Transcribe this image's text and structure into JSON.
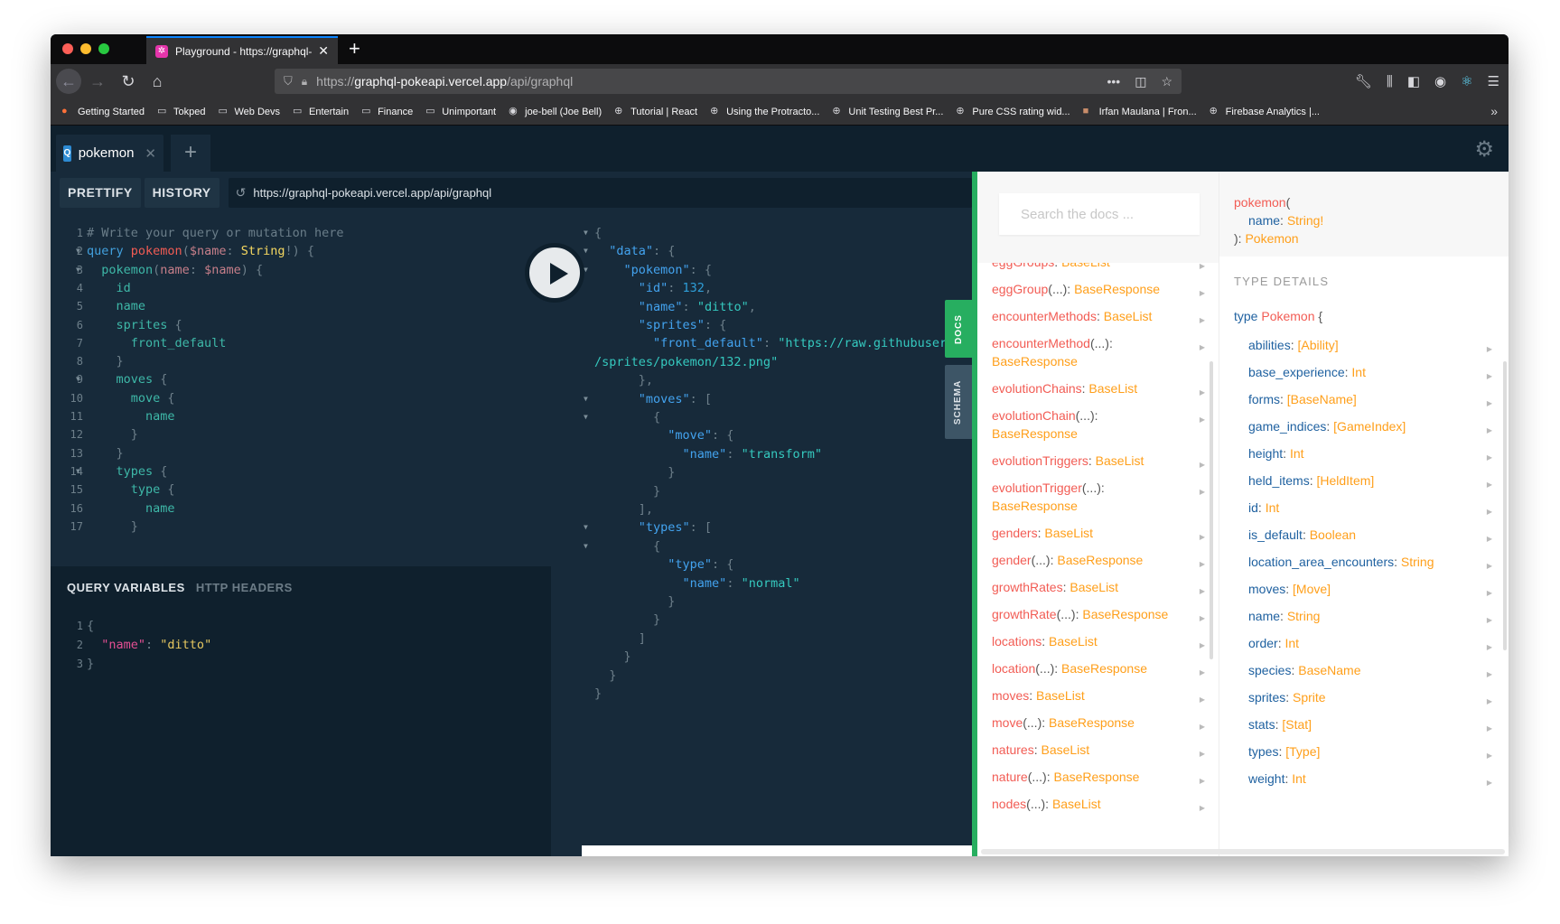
{
  "browser": {
    "tab_title": "Playground - https://graphql-p",
    "tab_favicon": "graphql-logo-icon",
    "url_prefix": "https://",
    "url_host": "graphql-pokeapi.vercel.app",
    "url_path": "/api/graphql",
    "bookmarks": [
      {
        "label": "Getting Started",
        "icon": "firefox-icon"
      },
      {
        "label": "Tokped",
        "icon": "folder-icon"
      },
      {
        "label": "Web Devs",
        "icon": "folder-icon"
      },
      {
        "label": "Entertain",
        "icon": "folder-icon"
      },
      {
        "label": "Finance",
        "icon": "folder-icon"
      },
      {
        "label": "Unimportant",
        "icon": "folder-icon"
      },
      {
        "label": "joe-bell (Joe Bell)",
        "icon": "github-icon"
      },
      {
        "label": "Tutorial | React",
        "icon": "globe-icon"
      },
      {
        "label": "Using the Protracto...",
        "icon": "globe-icon"
      },
      {
        "label": "Unit Testing Best Pr...",
        "icon": "globe-icon"
      },
      {
        "label": "Pure CSS rating wid...",
        "icon": "globe-icon"
      },
      {
        "label": "Irfan Maulana | Fron...",
        "icon": "avatar-icon"
      },
      {
        "label": "Firebase Analytics |...",
        "icon": "globe-icon"
      }
    ]
  },
  "playground": {
    "tab_badge": "Q",
    "tab_name": "pokemon",
    "prettify_label": "PRETTIFY",
    "history_label": "HISTORY",
    "endpoint": "https://graphql-pokeapi.vercel.app/api/graphql",
    "var_tabs": {
      "query_variables": "QUERY VARIABLES",
      "http_headers": "HTTP HEADERS"
    },
    "docs_tab": "DOCS",
    "schema_tab": "SCHEMA"
  },
  "query_lines": [
    {
      "n": "1",
      "fold": false,
      "tokens": [
        [
          "c-comment",
          "# Write your query or mutation here"
        ]
      ]
    },
    {
      "n": "2",
      "fold": true,
      "tokens": [
        [
          "c-kw",
          "query "
        ],
        [
          "c-def",
          "pokemon"
        ],
        [
          "c-punc",
          "("
        ],
        [
          "c-var",
          "$name"
        ],
        [
          "c-punc",
          ": "
        ],
        [
          "c-type",
          "String"
        ],
        [
          "c-punc",
          "!) {"
        ]
      ]
    },
    {
      "n": "3",
      "fold": true,
      "tokens": [
        [
          "c-field",
          "  pokemon"
        ],
        [
          "c-punc",
          "("
        ],
        [
          "c-var",
          "name"
        ],
        [
          "c-punc",
          ": "
        ],
        [
          "c-var",
          "$name"
        ],
        [
          "c-punc",
          ") {"
        ]
      ]
    },
    {
      "n": "4",
      "fold": false,
      "tokens": [
        [
          "c-field",
          "    id"
        ]
      ]
    },
    {
      "n": "5",
      "fold": false,
      "tokens": [
        [
          "c-field",
          "    name"
        ]
      ]
    },
    {
      "n": "6",
      "fold": false,
      "tokens": [
        [
          "c-field",
          "    sprites "
        ],
        [
          "c-punc",
          "{"
        ]
      ]
    },
    {
      "n": "7",
      "fold": false,
      "tokens": [
        [
          "c-field",
          "      front_default"
        ]
      ]
    },
    {
      "n": "8",
      "fold": false,
      "tokens": [
        [
          "c-punc",
          "    }"
        ]
      ]
    },
    {
      "n": "9",
      "fold": true,
      "tokens": [
        [
          "c-field",
          "    moves "
        ],
        [
          "c-punc",
          "{"
        ]
      ]
    },
    {
      "n": "10",
      "fold": false,
      "tokens": [
        [
          "c-field",
          "      move "
        ],
        [
          "c-punc",
          "{"
        ]
      ]
    },
    {
      "n": "11",
      "fold": false,
      "tokens": [
        [
          "c-field",
          "        name"
        ]
      ]
    },
    {
      "n": "12",
      "fold": false,
      "tokens": [
        [
          "c-punc",
          "      }"
        ]
      ]
    },
    {
      "n": "13",
      "fold": false,
      "tokens": [
        [
          "c-punc",
          "    }"
        ]
      ]
    },
    {
      "n": "14",
      "fold": true,
      "tokens": [
        [
          "c-field",
          "    types "
        ],
        [
          "c-punc",
          "{"
        ]
      ]
    },
    {
      "n": "15",
      "fold": false,
      "tokens": [
        [
          "c-field",
          "      type "
        ],
        [
          "c-punc",
          "{"
        ]
      ]
    },
    {
      "n": "16",
      "fold": false,
      "tokens": [
        [
          "c-field",
          "        name"
        ]
      ]
    },
    {
      "n": "17",
      "fold": false,
      "tokens": [
        [
          "c-punc",
          "      }"
        ]
      ]
    }
  ],
  "variable_lines": [
    {
      "n": "1",
      "tokens": [
        [
          "c-punc",
          "{"
        ]
      ]
    },
    {
      "n": "2",
      "tokens": [
        [
          "c-vkey",
          "  \"name\""
        ],
        [
          "c-punc",
          ": "
        ],
        [
          "c-vstr",
          "\"ditto\""
        ]
      ]
    },
    {
      "n": "3",
      "tokens": [
        [
          "c-punc",
          "}"
        ]
      ]
    }
  ],
  "result_lines": [
    {
      "fold": true,
      "tokens": [
        [
          "c-punc",
          "{"
        ]
      ]
    },
    {
      "fold": true,
      "tokens": [
        [
          "c-key",
          "  \"data\""
        ],
        [
          "c-punc",
          ": {"
        ]
      ]
    },
    {
      "fold": true,
      "tokens": [
        [
          "c-key",
          "    \"pokemon\""
        ],
        [
          "c-punc",
          ": {"
        ]
      ]
    },
    {
      "fold": false,
      "tokens": [
        [
          "c-key",
          "      \"id\""
        ],
        [
          "c-punc",
          ": "
        ],
        [
          "c-num",
          "132"
        ],
        [
          "c-punc",
          ","
        ]
      ]
    },
    {
      "fold": false,
      "tokens": [
        [
          "c-key",
          "      \"name\""
        ],
        [
          "c-punc",
          ": "
        ],
        [
          "c-str",
          "\"ditto\""
        ],
        [
          "c-punc",
          ","
        ]
      ]
    },
    {
      "fold": false,
      "tokens": [
        [
          "c-key",
          "      \"sprites\""
        ],
        [
          "c-punc",
          ": {"
        ]
      ]
    },
    {
      "fold": false,
      "tokens": [
        [
          "c-key",
          "        \"front_default\""
        ],
        [
          "c-punc",
          ": "
        ],
        [
          "c-str",
          "\"https://raw.githubusercontent.com/PokeAPI/sprites/master"
        ]
      ]
    },
    {
      "fold": false,
      "tokens": [
        [
          "c-str",
          "/sprites/pokemon/132.png\""
        ]
      ]
    },
    {
      "fold": false,
      "tokens": [
        [
          "c-punc",
          "      },"
        ]
      ]
    },
    {
      "fold": true,
      "tokens": [
        [
          "c-key",
          "      \"moves\""
        ],
        [
          "c-punc",
          ": ["
        ]
      ]
    },
    {
      "fold": true,
      "tokens": [
        [
          "c-punc",
          "        {"
        ]
      ]
    },
    {
      "fold": false,
      "tokens": [
        [
          "c-key",
          "          \"move\""
        ],
        [
          "c-punc",
          ": {"
        ]
      ]
    },
    {
      "fold": false,
      "tokens": [
        [
          "c-key",
          "            \"name\""
        ],
        [
          "c-punc",
          ": "
        ],
        [
          "c-str",
          "\"transform\""
        ]
      ]
    },
    {
      "fold": false,
      "tokens": [
        [
          "c-punc",
          "          }"
        ]
      ]
    },
    {
      "fold": false,
      "tokens": [
        [
          "c-punc",
          "        }"
        ]
      ]
    },
    {
      "fold": false,
      "tokens": [
        [
          "c-punc",
          "      ],"
        ]
      ]
    },
    {
      "fold": true,
      "tokens": [
        [
          "c-key",
          "      \"types\""
        ],
        [
          "c-punc",
          ": ["
        ]
      ]
    },
    {
      "fold": true,
      "tokens": [
        [
          "c-punc",
          "        {"
        ]
      ]
    },
    {
      "fold": false,
      "tokens": [
        [
          "c-key",
          "          \"type\""
        ],
        [
          "c-punc",
          ": {"
        ]
      ]
    },
    {
      "fold": false,
      "tokens": [
        [
          "c-key",
          "            \"name\""
        ],
        [
          "c-punc",
          ": "
        ],
        [
          "c-str",
          "\"normal\""
        ]
      ]
    },
    {
      "fold": false,
      "tokens": [
        [
          "c-punc",
          "          }"
        ]
      ]
    },
    {
      "fold": false,
      "tokens": [
        [
          "c-punc",
          "        }"
        ]
      ]
    },
    {
      "fold": false,
      "tokens": [
        [
          "c-punc",
          "      ]"
        ]
      ]
    },
    {
      "fold": false,
      "tokens": [
        [
          "c-punc",
          "    }"
        ]
      ]
    },
    {
      "fold": false,
      "tokens": [
        [
          "c-punc",
          "  }"
        ]
      ]
    },
    {
      "fold": false,
      "tokens": [
        [
          "c-punc",
          "}"
        ]
      ]
    }
  ],
  "docs": {
    "search_placeholder": "Search the docs ...",
    "root_fields": [
      {
        "name": "eggGroups",
        "args": false,
        "type": "BaseList"
      },
      {
        "name": "eggGroup",
        "args": true,
        "type": "BaseResponse"
      },
      {
        "name": "encounterMethods",
        "args": false,
        "type": "BaseList"
      },
      {
        "name": "encounterMethod",
        "args": true,
        "type": "BaseResponse"
      },
      {
        "name": "evolutionChains",
        "args": false,
        "type": "BaseList"
      },
      {
        "name": "evolutionChain",
        "args": true,
        "type": "BaseResponse"
      },
      {
        "name": "evolutionTriggers",
        "args": false,
        "type": "BaseList"
      },
      {
        "name": "evolutionTrigger",
        "args": true,
        "type": "BaseResponse"
      },
      {
        "name": "genders",
        "args": false,
        "type": "BaseList"
      },
      {
        "name": "gender",
        "args": true,
        "type": "BaseResponse"
      },
      {
        "name": "growthRates",
        "args": false,
        "type": "BaseList"
      },
      {
        "name": "growthRate",
        "args": true,
        "type": "BaseResponse"
      },
      {
        "name": "locations",
        "args": false,
        "type": "BaseList"
      },
      {
        "name": "location",
        "args": true,
        "type": "BaseResponse"
      },
      {
        "name": "moves",
        "args": false,
        "type": "BaseList"
      },
      {
        "name": "move",
        "args": true,
        "type": "BaseResponse"
      },
      {
        "name": "natures",
        "args": false,
        "type": "BaseList"
      },
      {
        "name": "nature",
        "args": true,
        "type": "BaseResponse"
      },
      {
        "name": "nodes",
        "args": true,
        "type": "BaseList"
      }
    ],
    "signature": {
      "fn": "pokemon",
      "arg": "name",
      "arg_type": "String!",
      "return_type": "Pokemon"
    },
    "type_details_title": "TYPE DETAILS",
    "type_keyword": "type",
    "type_name": "Pokemon",
    "type_fields": [
      {
        "name": "abilities",
        "type": "[Ability]"
      },
      {
        "name": "base_experience",
        "type": "Int"
      },
      {
        "name": "forms",
        "type": "[BaseName]"
      },
      {
        "name": "game_indices",
        "type": "[GameIndex]"
      },
      {
        "name": "height",
        "type": "Int"
      },
      {
        "name": "held_items",
        "type": "[HeldItem]"
      },
      {
        "name": "id",
        "type": "Int"
      },
      {
        "name": "is_default",
        "type": "Boolean"
      },
      {
        "name": "location_area_encounters",
        "type": "String"
      },
      {
        "name": "moves",
        "type": "[Move]"
      },
      {
        "name": "name",
        "type": "String"
      },
      {
        "name": "order",
        "type": "Int"
      },
      {
        "name": "species",
        "type": "BaseName"
      },
      {
        "name": "sprites",
        "type": "Sprite"
      },
      {
        "name": "stats",
        "type": "[Stat]"
      },
      {
        "name": "types",
        "type": "[Type]"
      },
      {
        "name": "weight",
        "type": "Int"
      }
    ]
  }
}
